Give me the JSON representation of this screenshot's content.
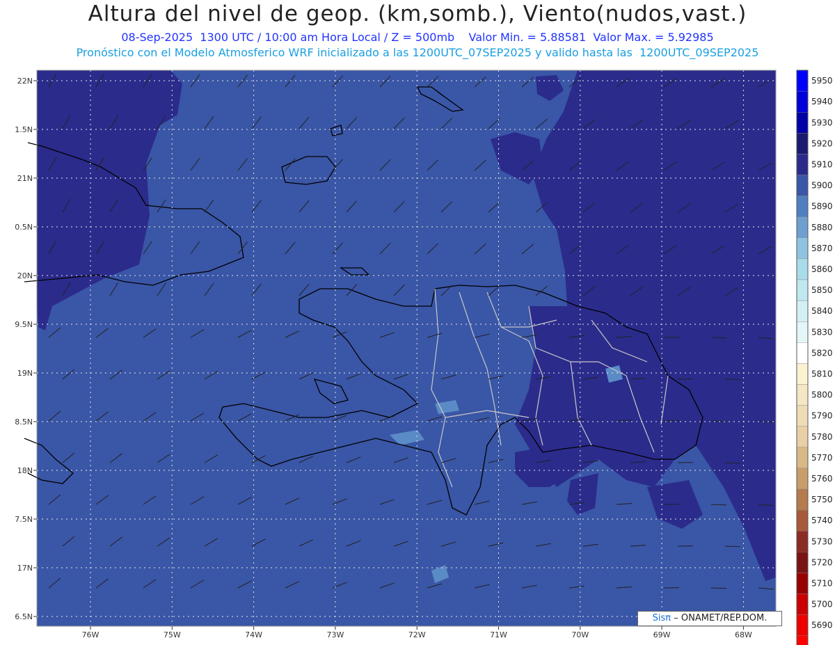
{
  "header": {
    "title": "Altura del nivel de geop. (km,somb.), Viento(nudos,vast.)",
    "subtitle_line1": "08-Sep-2025  1300 UTC / 10:00 am Hora Local / Z = 500mb    Valor Min. = 5.88581  Valor Max. = 5.92985",
    "subtitle_line2": "Pronóstico con el Modelo Atmosferico WRF inicializado a las 1200UTC_07SEP2025 y valido hasta las  1200UTC_09SEP2025"
  },
  "axes": {
    "lat_labels": [
      "22N",
      "1.5N",
      "21N",
      "0.5N",
      "20N",
      "9.5N",
      "19N",
      "8.5N",
      "18N",
      "7.5N",
      "17N",
      "6.5N"
    ],
    "lon_labels": [
      "76W",
      "75W",
      "74W",
      "73W",
      "72W",
      "71W",
      "70W",
      "69W",
      "68W"
    ]
  },
  "colorbar": {
    "levels": [
      "5950",
      "5940",
      "5930",
      "5920",
      "5910",
      "5900",
      "5890",
      "5880",
      "5870",
      "5860",
      "5850",
      "5840",
      "5830",
      "5820",
      "5810",
      "5800",
      "5790",
      "5780",
      "5770",
      "5760",
      "5750",
      "5740",
      "5730",
      "5720",
      "5710",
      "5700",
      "5690"
    ],
    "colors": [
      "#0000ff",
      "#0000d9",
      "#0000a6",
      "#1a1a70",
      "#2b2b8c",
      "#3a56a6",
      "#4f7fc0",
      "#6f9fd0",
      "#8fc4e0",
      "#a9dcea",
      "#c0e8f0",
      "#d4f0f4",
      "#e4f6f8",
      "#ffffff",
      "#fbf2d0",
      "#f6e7c4",
      "#efdcb6",
      "#e8cfa6",
      "#d9b888",
      "#c99e6a",
      "#b57b4c",
      "#a85a3a",
      "#8c2a24",
      "#7a1414",
      "#990000",
      "#cc0000",
      "#ee0000",
      "#ff0000"
    ]
  },
  "credit": {
    "brand": "Sisπ",
    "text": "– ONAMET/REP.DOM."
  },
  "colors": {
    "field_main": "#3a56a6",
    "field_high": "#2b2b8c",
    "field_low": "#5b8bc6"
  }
}
